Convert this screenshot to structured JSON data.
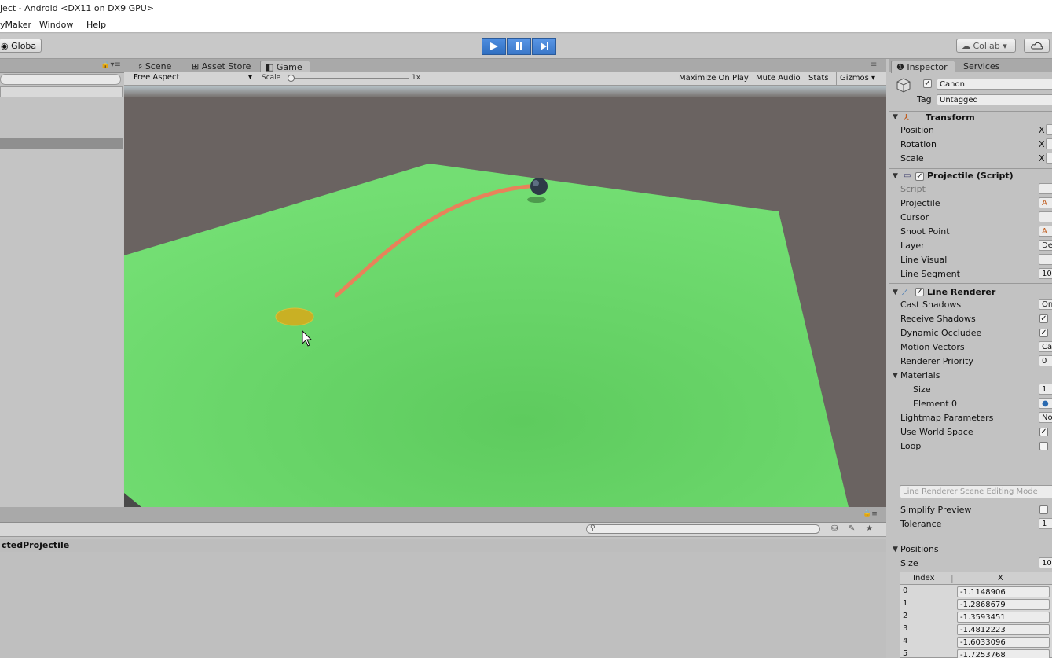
{
  "window": {
    "title": "ject - Android <DX11 on DX9 GPU>",
    "menu": [
      "yMaker",
      "Window",
      "Help"
    ]
  },
  "toolbar": {
    "layers_button": "Globa",
    "collab_button": "Collab",
    "cloud_icon": "cloud-icon",
    "play_icon": "play-icon",
    "pause_icon": "pause-icon",
    "step_icon": "step-icon",
    "accent": "#3a7bd5"
  },
  "hierarchy": {
    "menu_icon": "lock-icon"
  },
  "center_tabs": {
    "scene": "Scene",
    "asset_store": "Asset Store",
    "game": "Game"
  },
  "game_toolbar": {
    "aspect": "Free Aspect",
    "scale_label": "Scale",
    "scale_value": "1x",
    "maximize": "Maximize On Play",
    "mute": "Mute Audio",
    "stats": "Stats",
    "gizmos": "Gizmos"
  },
  "game_view": {
    "sky_color": "#6a6361",
    "ground_color": "#66d466",
    "trajectory_color": "#e8825a",
    "target_color": "#c9b024"
  },
  "console": {
    "search_placeholder": "",
    "selected_item": "ctedProjectile"
  },
  "inspector": {
    "tabs": [
      "Inspector",
      "Services"
    ],
    "object_name": "Canon",
    "tag_label": "Tag",
    "tag_value": "Untagged",
    "transform": {
      "title": "Transform",
      "rows": [
        "Position",
        "Rotation",
        "Scale"
      ],
      "axis": "X"
    },
    "projectile_script": {
      "title": "Projectile (Script)",
      "rows": [
        "Script",
        "Projectile",
        "Cursor",
        "Shoot Point",
        "Layer",
        "Line Visual",
        "Line Segment"
      ],
      "values": [
        "",
        "A",
        "",
        "A",
        "De",
        "",
        "10"
      ]
    },
    "line_renderer": {
      "title": "Line Renderer",
      "rows": [
        "Cast Shadows",
        "Receive Shadows",
        "Dynamic Occludee",
        "Motion Vectors",
        "Renderer Priority"
      ],
      "values": [
        "On",
        "",
        "",
        "Ca",
        "0"
      ],
      "materials_label": "Materials",
      "size_label": "Size",
      "size_value": "1",
      "element_label": "Element 0",
      "lightmap_label": "Lightmap Parameters",
      "lightmap_value": "No",
      "world_space_label": "Use World Space",
      "loop_label": "Loop",
      "edit_mode_button": "Line Renderer Scene Editing Mode",
      "simplify_label": "Simplify Preview",
      "tolerance_label": "Tolerance",
      "tolerance_value": "1"
    },
    "positions": {
      "title": "Positions",
      "size_label": "Size",
      "size_value": "10",
      "col_index": "Index",
      "col_x": "X",
      "rows": [
        {
          "i": "0",
          "x": "-1.1148906"
        },
        {
          "i": "1",
          "x": "-1.2868679"
        },
        {
          "i": "2",
          "x": "-1.3593451"
        },
        {
          "i": "3",
          "x": "-1.4812223"
        },
        {
          "i": "4",
          "x": "-1.6033096"
        },
        {
          "i": "5",
          "x": "-1.7253768"
        }
      ]
    }
  }
}
